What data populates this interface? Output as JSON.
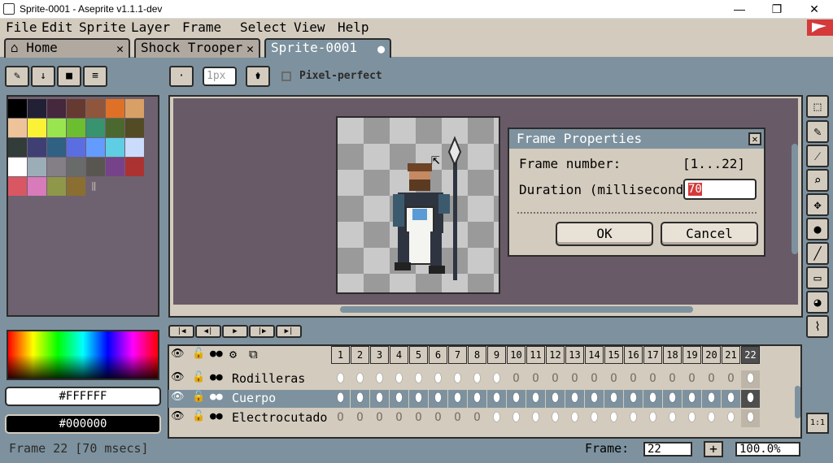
{
  "window": {
    "title": "Sprite-0001 - Aseprite v1.1.1-dev",
    "minimize": "—",
    "maximize": "❐",
    "close": "✕"
  },
  "menu": [
    "File",
    "Edit",
    "Sprite",
    "Layer",
    "Frame",
    "Select",
    "View",
    "Help"
  ],
  "tabs": [
    {
      "label": "Home",
      "icon": "home-icon",
      "close": "✕"
    },
    {
      "label": "Shock Trooper",
      "close": "✕"
    },
    {
      "label": "Sprite-0001",
      "close": "●"
    }
  ],
  "context_bar": {
    "brush_size": "1px",
    "pixel_perfect_label": "Pixel-perfect",
    "dot_symbol": "·"
  },
  "palette_toolbar": [
    "pencil-icon",
    "arrow-down-icon",
    "folder-icon",
    "menu-icon"
  ],
  "palette_colors": [
    "#000000",
    "#222034",
    "#45283c",
    "#663931",
    "#8f563b",
    "#df7126",
    "#d9a066",
    "#eec39a",
    "#fbf236",
    "#99e550",
    "#6abe30",
    "#37946e",
    "#4b692f",
    "#524b24",
    "#323c39",
    "#3f3f74",
    "#306082",
    "#5b6ee1",
    "#639bff",
    "#5fcde4",
    "#cbdbfc",
    "#ffffff",
    "#9badb7",
    "#847e87",
    "#696a6a",
    "#595652",
    "#76428a",
    "#ac3232",
    "#d95763",
    "#d77bba",
    "#8f974a",
    "#8a6f30"
  ],
  "colors": {
    "foreground": "#FFFFFF",
    "background": "#000000"
  },
  "dialog": {
    "title": "Frame Properties",
    "close": "✕",
    "frame_number_label": "Frame number:",
    "frame_number_value": "[1...22]",
    "duration_label": "Duration (milliseconds):",
    "duration_value_selected": "70",
    "ok": "OK",
    "cancel": "Cancel"
  },
  "tools": [
    "marquee-icon",
    "pencil-icon",
    "eyedropper-icon",
    "zoom-icon",
    "move-icon",
    "fill-icon",
    "line-icon",
    "rectangle-icon",
    "blur-icon",
    "contour-icon"
  ],
  "timeline": {
    "controls": [
      "first-frame-icon",
      "prev-frame-icon",
      "play-icon",
      "next-frame-icon",
      "last-frame-icon"
    ],
    "header_icons": [
      "eye-icon",
      "lock-icon",
      "onion-dots-icon",
      "gear-icon",
      "onion-skin-icon"
    ],
    "frames": [
      "1",
      "2",
      "3",
      "4",
      "5",
      "6",
      "7",
      "8",
      "9",
      "10",
      "11",
      "12",
      "13",
      "14",
      "15",
      "16",
      "17",
      "18",
      "19",
      "20",
      "21",
      "22"
    ],
    "current_frame_index": 21,
    "layers": [
      {
        "name": "Rodilleras",
        "cels": "FFFFFFFFFEEEEEEEEEEEEF",
        "selected": false
      },
      {
        "name": "Cuerpo",
        "cels": "FFFFFFFFFFFFFFFFFFFFFF",
        "selected": true
      },
      {
        "name": "Electrocutado",
        "cels": "EEEEEEEEFFFFFFFFFFFFFF",
        "selected": false
      }
    ]
  },
  "status": {
    "frame_info": "Frame 22 [70 msecs]",
    "frame_label": "Frame:",
    "frame_value": "22",
    "plus": "+",
    "zoom": "100.0%",
    "ratio": "1:1"
  }
}
